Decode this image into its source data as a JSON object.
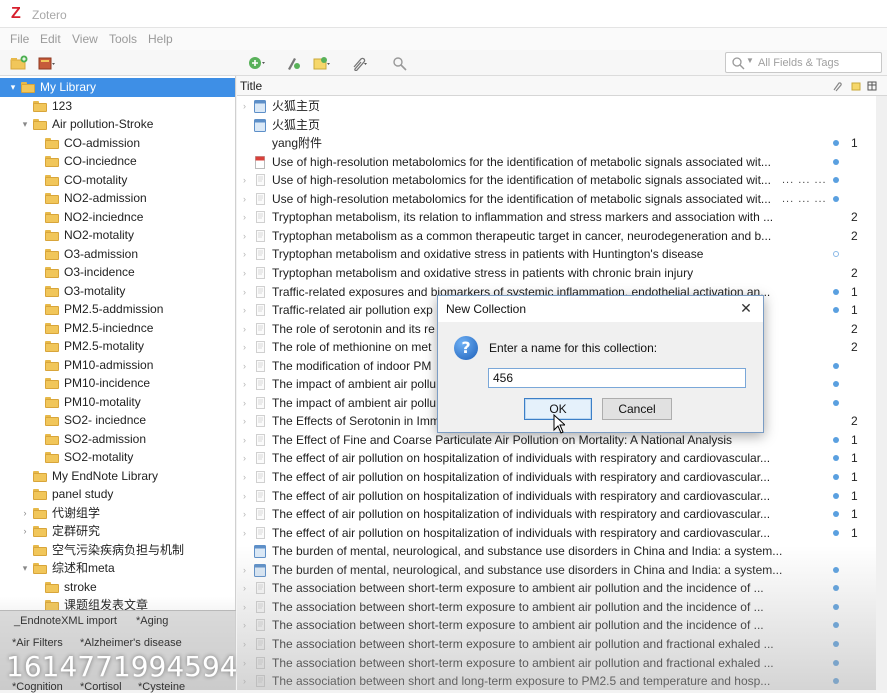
{
  "window": {
    "title": "Zotero",
    "logo_letter": "Z"
  },
  "menu": [
    "File",
    "Edit",
    "View",
    "Tools",
    "Help"
  ],
  "search": {
    "placeholder": "All Fields & Tags"
  },
  "items_header": {
    "title_column": "Title"
  },
  "collections": [
    {
      "label": "My Library",
      "level": 0,
      "twisty": "▾",
      "selected": true
    },
    {
      "label": "123",
      "level": 1,
      "twisty": ""
    },
    {
      "label": "Air pollution-Stroke",
      "level": 1,
      "twisty": "▾"
    },
    {
      "label": "CO-admission",
      "level": 2,
      "twisty": ""
    },
    {
      "label": "CO-inciednce",
      "level": 2,
      "twisty": ""
    },
    {
      "label": "CO-motality",
      "level": 2,
      "twisty": ""
    },
    {
      "label": "NO2-admission",
      "level": 2,
      "twisty": ""
    },
    {
      "label": "NO2-inciednce",
      "level": 2,
      "twisty": ""
    },
    {
      "label": "NO2-motality",
      "level": 2,
      "twisty": ""
    },
    {
      "label": "O3-admission",
      "level": 2,
      "twisty": ""
    },
    {
      "label": "O3-incidence",
      "level": 2,
      "twisty": ""
    },
    {
      "label": "O3-motality",
      "level": 2,
      "twisty": ""
    },
    {
      "label": "PM2.5-addmission",
      "level": 2,
      "twisty": ""
    },
    {
      "label": "PM2.5-inciednce",
      "level": 2,
      "twisty": ""
    },
    {
      "label": "PM2.5-motality",
      "level": 2,
      "twisty": ""
    },
    {
      "label": "PM10-admission",
      "level": 2,
      "twisty": ""
    },
    {
      "label": "PM10-incidence",
      "level": 2,
      "twisty": ""
    },
    {
      "label": "PM10-motality",
      "level": 2,
      "twisty": ""
    },
    {
      "label": "SO2- inciednce",
      "level": 2,
      "twisty": ""
    },
    {
      "label": "SO2-admission",
      "level": 2,
      "twisty": ""
    },
    {
      "label": "SO2-motality",
      "level": 2,
      "twisty": ""
    },
    {
      "label": "My EndNote Library",
      "level": 1,
      "twisty": ""
    },
    {
      "label": "panel study",
      "level": 1,
      "twisty": ""
    },
    {
      "label": "代谢组学",
      "level": 1,
      "twisty": "›"
    },
    {
      "label": "定群研究",
      "level": 1,
      "twisty": "›"
    },
    {
      "label": "空气污染疾病负担与机制",
      "level": 1,
      "twisty": ""
    },
    {
      "label": "综述和meta",
      "level": 1,
      "twisty": "▾"
    },
    {
      "label": "stroke",
      "level": 2,
      "twisty": ""
    },
    {
      "label": "课题组发表文章",
      "level": 2,
      "twisty": ""
    }
  ],
  "tags": [
    {
      "label": "_EndnoteXML import"
    },
    {
      "label": "*Aging"
    },
    {
      "label": "*Air Filters"
    },
    {
      "label": "*Alzheimer's disease"
    },
    {
      "label": "*Cognition"
    },
    {
      "label": "*Cortisol"
    },
    {
      "label": "*Cysteine"
    }
  ],
  "watermark": "1614771994594",
  "items": [
    {
      "title": "火狐主页",
      "twisty": "›",
      "icon": "webpage",
      "dots": "",
      "att": "",
      "num": ""
    },
    {
      "title": "火狐主页",
      "twisty": "",
      "icon": "webpage",
      "dots": "",
      "att": "",
      "num": ""
    },
    {
      "title": "yang附件",
      "twisty": "",
      "icon": "none",
      "dots": "",
      "att": "filled",
      "num": "1"
    },
    {
      "title": "Use of high-resolution metabolomics for the identification of metabolic signals associated wit...",
      "twisty": "",
      "icon": "pdf",
      "dots": "",
      "att": "filled",
      "num": ""
    },
    {
      "title": "Use of high-resolution metabolomics for the identification of metabolic signals associated wit...",
      "twisty": "›",
      "icon": "article",
      "dots": "... ... ...",
      "att": "filled",
      "num": ""
    },
    {
      "title": "Use of high-resolution metabolomics for the identification of metabolic signals associated wit...",
      "twisty": "›",
      "icon": "article",
      "dots": "... ... ...",
      "att": "filled",
      "num": ""
    },
    {
      "title": "Tryptophan metabolism, its relation to inflammation and stress markers and association with ...",
      "twisty": "›",
      "icon": "article",
      "dots": "",
      "att": "",
      "num": "2"
    },
    {
      "title": "Tryptophan metabolism as a common therapeutic target in cancer, neurodegeneration and b...",
      "twisty": "›",
      "icon": "article",
      "dots": "",
      "att": "",
      "num": "2"
    },
    {
      "title": "Tryptophan metabolism and oxidative stress in patients with Huntington's disease",
      "twisty": "›",
      "icon": "article",
      "dots": "",
      "att": "hollow",
      "num": ""
    },
    {
      "title": "Tryptophan metabolism and oxidative stress in patients with chronic brain injury",
      "twisty": "›",
      "icon": "article",
      "dots": "",
      "att": "",
      "num": "2"
    },
    {
      "title": "Traffic-related exposures and biomarkers of systemic inflammation, endothelial activation an...",
      "twisty": "›",
      "icon": "article",
      "dots": "",
      "att": "filled",
      "num": "1"
    },
    {
      "title": "Traffic-related air pollution exp",
      "twisty": "›",
      "icon": "article",
      "dots": "",
      "att": "filled",
      "num": "1"
    },
    {
      "title": "The role of serotonin and its re",
      "twisty": "›",
      "icon": "article",
      "dots": "",
      "att": "",
      "num": "2"
    },
    {
      "title": "The role of methionine on met",
      "twisty": "›",
      "icon": "article",
      "dots": "",
      "att": "",
      "num": "2"
    },
    {
      "title": "The modification of indoor PM",
      "twisty": "›",
      "icon": "article",
      "dots": "",
      "att": "filled",
      "num": ""
    },
    {
      "title": "The impact of ambient air pollu",
      "twisty": "›",
      "icon": "article",
      "dots": "",
      "att": "filled",
      "num": ""
    },
    {
      "title": "The impact of ambient air pollu",
      "twisty": "›",
      "icon": "article",
      "dots": "",
      "att": "filled",
      "num": ""
    },
    {
      "title": "The Effects of Serotonin in Imm",
      "twisty": "›",
      "icon": "article",
      "dots": "",
      "att": "",
      "num": "2"
    },
    {
      "title": "The Effect of Fine and Coarse Particulate Air Pollution on Mortality: A National Analysis",
      "twisty": "›",
      "icon": "article",
      "dots": "",
      "att": "filled",
      "num": "1"
    },
    {
      "title": "The effect of air pollution on hospitalization of individuals with respiratory and cardiovascular...",
      "twisty": "›",
      "icon": "article",
      "dots": "",
      "att": "filled",
      "num": "1"
    },
    {
      "title": "The effect of air pollution on hospitalization of individuals with respiratory and cardiovascular...",
      "twisty": "›",
      "icon": "article",
      "dots": "",
      "att": "filled",
      "num": "1"
    },
    {
      "title": "The effect of air pollution on hospitalization of individuals with respiratory and cardiovascular...",
      "twisty": "›",
      "icon": "article",
      "dots": "",
      "att": "filled",
      "num": "1"
    },
    {
      "title": "The effect of air pollution on hospitalization of individuals with respiratory and cardiovascular...",
      "twisty": "›",
      "icon": "article",
      "dots": "",
      "att": "filled",
      "num": "1"
    },
    {
      "title": "The effect of air pollution on hospitalization of individuals with respiratory and cardiovascular...",
      "twisty": "›",
      "icon": "article",
      "dots": "",
      "att": "filled",
      "num": "1"
    },
    {
      "title": "The burden of mental, neurological, and substance use disorders in China and India: a system...",
      "twisty": "",
      "icon": "webpage",
      "dots": "",
      "att": "",
      "num": ""
    },
    {
      "title": "The burden of mental, neurological, and substance use disorders in China and India: a system...",
      "twisty": "›",
      "icon": "webpage",
      "dots": "",
      "att": "filled",
      "num": ""
    },
    {
      "title": "The association between short-term exposure to ambient air pollution and the incidence of ...",
      "twisty": "›",
      "icon": "article",
      "dots": "",
      "att": "filled",
      "num": ""
    },
    {
      "title": "The association between short-term exposure to ambient air pollution and the incidence of ...",
      "twisty": "›",
      "icon": "article",
      "dots": "",
      "att": "filled",
      "num": ""
    },
    {
      "title": "The association between short-term exposure to ambient air pollution and the incidence of ...",
      "twisty": "›",
      "icon": "article",
      "dots": "",
      "att": "filled",
      "num": ""
    },
    {
      "title": "The association between short-term exposure to ambient air pollution and fractional exhaled ...",
      "twisty": "›",
      "icon": "article",
      "dots": "",
      "att": "filled",
      "num": ""
    },
    {
      "title": "The association between short-term exposure to ambient air pollution and fractional exhaled ...",
      "twisty": "›",
      "icon": "article",
      "dots": "",
      "att": "filled",
      "num": ""
    },
    {
      "title": "The association between short and long-term exposure to PM2.5 and temperature and hosp...",
      "twisty": "›",
      "icon": "article",
      "dots": "",
      "att": "filled",
      "num": ""
    }
  ],
  "dialog": {
    "title": "New Collection",
    "message": "Enter a name for this collection:",
    "input_value": "456",
    "ok_label": "OK",
    "cancel_label": "Cancel"
  },
  "colors": {
    "selection": "#3e8fe6",
    "folder": "#f1c65a",
    "dialog_border": "#7a9cc4",
    "logo": "#d71f2d"
  }
}
